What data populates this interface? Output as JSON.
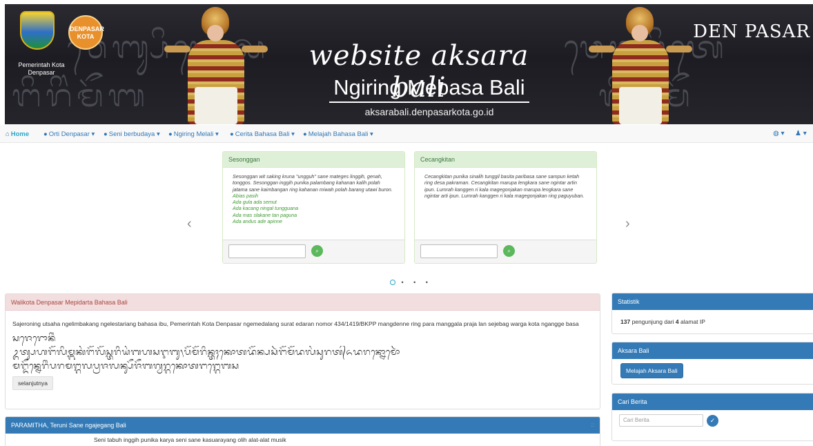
{
  "banner": {
    "pemkot": "Pemerintah Kota Denpasar",
    "logo2": "DENPASAR KOTA",
    "title": "website aksara bali",
    "subtitle": "Ngiring Mebasa Bali",
    "domain": "aksarabali.denpasarkota.go.id",
    "right_logo": "DEN PASAR"
  },
  "nav": {
    "home": "Home",
    "items": [
      "Orti Denpasar",
      "Seni berbudaya",
      "Ngiring Melali",
      "Cerita Bahasa Bali",
      "Melajah Bahasa Bali"
    ]
  },
  "cards": [
    {
      "title": "Sesonggan",
      "body": "Sesonggan wit saking kruna \"ungguh\" sane mateges linggih, genah, tonggos. Sesonggan inggih punika palambang kahanan kalih polah jatama sane kaimbangan ring kahanan miwah polah barang utawi buron.",
      "examples": [
        "Abias pasih",
        "Ada gula ada semut",
        "Ada kacang ningal tungguana",
        "Ada mas slakane tan paguna",
        "Ada andus ade apinne"
      ]
    },
    {
      "title": "Cecangkitan",
      "body": "Cecangkitan punika sinalih tunggil basita paribasa sane sampun ketah ring desa pakraman. Cecangkitan marupa lengkara sane ngintar artin ipun. Lumrah kanggen ri kala magegonjakan marupa lengkara sane ngintar arti ipun. Lumrah kanggen ri kala magegonjakan ring paguyuban.",
      "examples": []
    }
  ],
  "news": {
    "title": "Walikota Denpasar Mepidarta Bahasa Bali",
    "text": "Sajeroning utsaha ngelimbakang ngelestariang bahasa ibu, Pemerintah Kota Denpasar ngemedalang surat edaran nomor 434/1419/BKPP mangdenne ring para manggala praja lan sejebag warga kota ngangge basa",
    "script_line1": "ᬲᬚᬾᬭᭀᬦᬶᬂ",
    "script_line2": "ᬉᬢ᭄ᬲᬳᬗᭂᬮᬶᬫ᭄ᬩᬓᬂᬗᭂᬮᭂᬲ᭄ᬢᬭᬶᬬᬂᬩᬳᬲᬇᬩᬸ᭞ᬧᭂᬫᭂᬭᬶᬦ᭄ᬢᬄᬓᭀᬢᬤᭂᬦ᭄ᬧᬲᬃᬗᭂᬫᭂᬤᬮᬂᬲᬸᬭᬢ᭄ᬏᬤᬭᬦ᭄ᬦᭀᬫᭀᬃ",
    "script_line3": "ᬫᬗ᭄ᬤᭂᬦ᭄ᬦᬾᬭᬶᬂᬧᬭᬫᬗ᭄ᬕᬮᬧ᭄ᬭᬚᬮᬦ᭄ᬲᭂᬚᭂᬩᬕ᭄ᬯᬭ᭄ᬕᬓᭀᬢᬗᬗ᭄ᬕᬾᬩᬲ",
    "more": "selanjutnya"
  },
  "paramitha": {
    "title": "PARAMITHA, Teruni Sane ngajegang Bali",
    "text": "Seni tabuh inggih punika  karya seni sane kasuarayang  olih  alat-alat musik"
  },
  "sidebar": {
    "statistik_title": "Statistik",
    "visitors": "137",
    "visitors_mid": "pengunjung dari",
    "ips": "4",
    "ips_suffix": "alamat IP",
    "aksara_title": "Aksara Bali",
    "aksara_button": "Melajah Aksara Bali",
    "cari_title": "Cari Berita",
    "search_placeholder": "Cari Berita"
  }
}
